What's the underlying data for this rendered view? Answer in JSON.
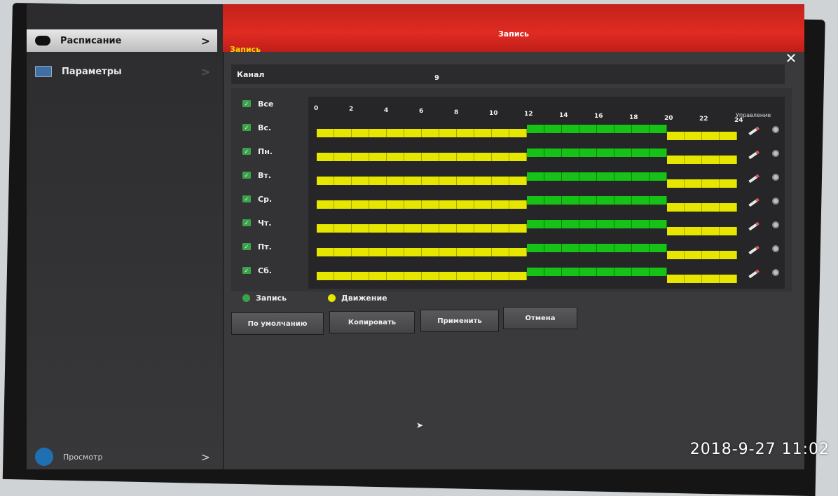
{
  "window": {
    "title": "Запись",
    "breadcrumb": "Запись",
    "close_glyph": "✕"
  },
  "sidebar": {
    "items": [
      {
        "label": "Расписание",
        "chevron": ">"
      },
      {
        "label": "Параметры",
        "chevron": ">"
      },
      {
        "label": "Просмотр",
        "chevron": ">"
      }
    ]
  },
  "channel": {
    "label": "Канал",
    "value": "9"
  },
  "schedule": {
    "select_all": "Все",
    "hours": [
      "0",
      "2",
      "4",
      "6",
      "8",
      "10",
      "12",
      "14",
      "16",
      "18",
      "20",
      "22",
      "24"
    ],
    "manage_label": "Управление",
    "days": [
      {
        "label": "Вс.",
        "segments": [
          {
            "type": "record",
            "start": 0,
            "end": 12
          },
          {
            "type": "motion",
            "start": 12,
            "end": 20
          },
          {
            "type": "record",
            "start": 20,
            "end": 24
          }
        ]
      },
      {
        "label": "Пн.",
        "segments": [
          {
            "type": "record",
            "start": 0,
            "end": 12
          },
          {
            "type": "motion",
            "start": 12,
            "end": 20
          },
          {
            "type": "record",
            "start": 20,
            "end": 24
          }
        ]
      },
      {
        "label": "Вт.",
        "segments": [
          {
            "type": "record",
            "start": 0,
            "end": 12
          },
          {
            "type": "motion",
            "start": 12,
            "end": 20
          },
          {
            "type": "record",
            "start": 20,
            "end": 24
          }
        ]
      },
      {
        "label": "Ср.",
        "segments": [
          {
            "type": "record",
            "start": 0,
            "end": 12
          },
          {
            "type": "motion",
            "start": 12,
            "end": 20
          },
          {
            "type": "record",
            "start": 20,
            "end": 24
          }
        ]
      },
      {
        "label": "Чт.",
        "segments": [
          {
            "type": "record",
            "start": 0,
            "end": 12
          },
          {
            "type": "motion",
            "start": 12,
            "end": 20
          },
          {
            "type": "record",
            "start": 20,
            "end": 24
          }
        ]
      },
      {
        "label": "Пт.",
        "segments": [
          {
            "type": "record",
            "start": 0,
            "end": 12
          },
          {
            "type": "motion",
            "start": 12,
            "end": 20
          },
          {
            "type": "record",
            "start": 20,
            "end": 24
          }
        ]
      },
      {
        "label": "Сб.",
        "segments": [
          {
            "type": "record",
            "start": 0,
            "end": 12
          },
          {
            "type": "motion",
            "start": 12,
            "end": 20
          },
          {
            "type": "record",
            "start": 20,
            "end": 24
          }
        ]
      }
    ]
  },
  "legend": {
    "record": {
      "label": "Запись",
      "color": "#3aa34a"
    },
    "motion": {
      "label": "Движение",
      "color": "#e6e600"
    }
  },
  "colors": {
    "record_bar": "#e6e600",
    "motion_bar": "#17c217",
    "title_bar": "#d8241d",
    "breadcrumb": "#f0d800"
  },
  "buttons": {
    "default": "По умолчанию",
    "copy": "Копировать",
    "apply": "Применить",
    "cancel": "Отмена"
  },
  "timestamp": "2018-9-27 11:02"
}
